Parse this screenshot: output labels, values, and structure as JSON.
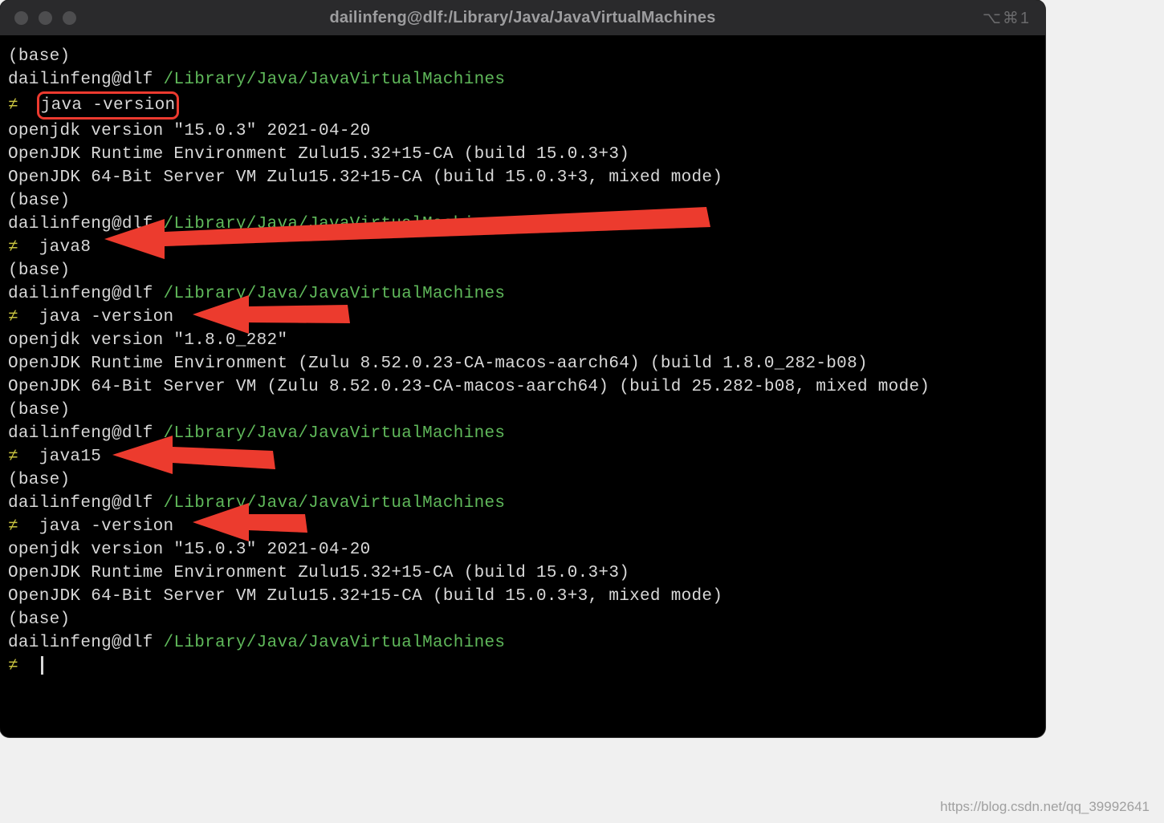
{
  "titlebar": {
    "title": "dailinfeng@dlf:/Library/Java/JavaVirtualMachines",
    "shortcut": "⌥⌘1"
  },
  "prompt": {
    "base": "(base)",
    "userhost": "dailinfeng@dlf",
    "cwd": "/Library/Java/JavaVirtualMachines",
    "sym": "≠"
  },
  "lines": {
    "c1": "java -version",
    "o1a": "openjdk version \"15.0.3\" 2021-04-20",
    "o1b": "OpenJDK Runtime Environment Zulu15.32+15-CA (build 15.0.3+3)",
    "o1c": "OpenJDK 64-Bit Server VM Zulu15.32+15-CA (build 15.0.3+3, mixed mode)",
    "c2": "java8",
    "c3": "java -version",
    "o3a": "openjdk version \"1.8.0_282\"",
    "o3b": "OpenJDK Runtime Environment (Zulu 8.52.0.23-CA-macos-aarch64) (build 1.8.0_282-b08)",
    "o3c": "OpenJDK 64-Bit Server VM (Zulu 8.52.0.23-CA-macos-aarch64) (build 25.282-b08, mixed mode)",
    "c4": "java15",
    "c5": "java -version",
    "o5a": "openjdk version \"15.0.3\" 2021-04-20",
    "o5b": "OpenJDK Runtime Environment Zulu15.32+15-CA (build 15.0.3+3)",
    "o5c": "OpenJDK 64-Bit Server VM Zulu15.32+15-CA (build 15.0.3+3, mixed mode)"
  },
  "watermark": "https://blog.csdn.net/qq_39992641"
}
